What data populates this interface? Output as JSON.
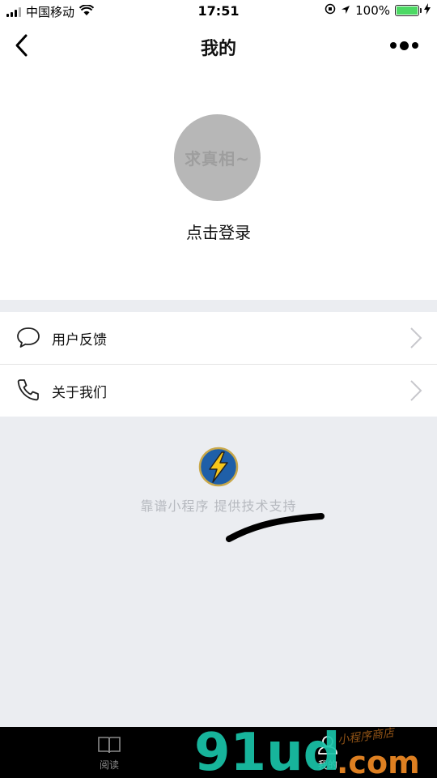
{
  "status_bar": {
    "carrier": "中国移动",
    "time": "17:51",
    "battery": "100%",
    "battery_level": 1.0,
    "icons": [
      "signal-icon",
      "wifi-icon",
      "orientation-lock-icon",
      "location-icon",
      "battery-icon",
      "charging-icon"
    ]
  },
  "nav": {
    "title": "我的",
    "back_icon": "chevron-left-icon",
    "more_icon": "more-dots-icon"
  },
  "profile": {
    "avatar_text": "求真相~",
    "login_label": "点击登录"
  },
  "menu": {
    "items": [
      {
        "label": "用户反馈",
        "icon": "chat-bubble-icon"
      },
      {
        "label": "关于我们",
        "icon": "phone-icon"
      }
    ]
  },
  "footer": {
    "brand_text": "靠谱小程序 提供技术支持",
    "logo_icon": "lightning-icon"
  },
  "tab_bar": {
    "tabs": [
      {
        "label": "阅读",
        "icon": "book-icon",
        "active": false
      },
      {
        "label": "我的",
        "icon": "person-icon",
        "active": true
      }
    ]
  },
  "watermark": {
    "text": "91ud.com",
    "subtext": "小程序商店"
  },
  "colors": {
    "background": "#ebedf1",
    "battery_green": "#4cd964",
    "avatar_gray": "#b7b7b7",
    "brand_text": "#b6b9bf",
    "tab_bar": "#000000"
  }
}
